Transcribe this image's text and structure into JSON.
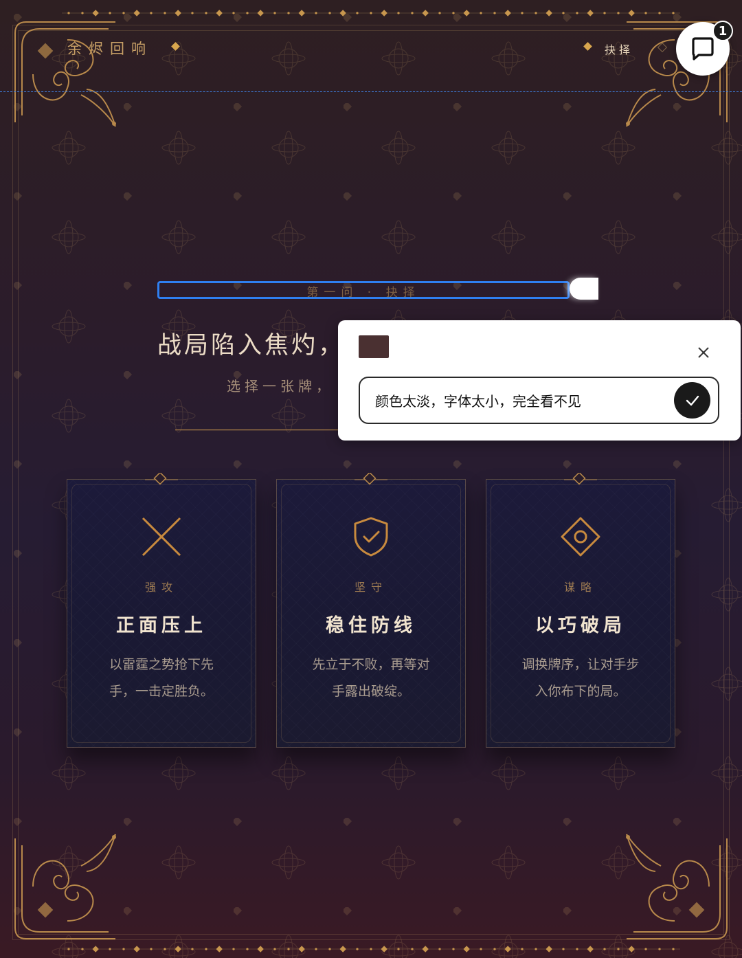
{
  "header": {
    "logo": "余烬回响",
    "nav_choice": "抉择"
  },
  "chat": {
    "badge_count": "1"
  },
  "main": {
    "section_label": "第一问 · 抉择",
    "headline": "战局陷入焦灼，",
    "subline": "选择一张牌，"
  },
  "feedback_popup": {
    "input_value": "颜色太淡，字体太小，完全看不见",
    "swatch_color": "#4a3031"
  },
  "cards": [
    {
      "tag": "强攻",
      "title": "正面压上",
      "desc_line1": "以雷霆之势抢下先",
      "desc_line2": "手，一击定胜负。",
      "icon": "crossed-swords-icon"
    },
    {
      "tag": "坚守",
      "title": "稳住防线",
      "desc_line1": "先立于不败，再等对",
      "desc_line2": "手露出破绽。",
      "icon": "shield-check-icon"
    },
    {
      "tag": "谋略",
      "title": "以巧破局",
      "desc_line1": "调换牌序，让对手步",
      "desc_line2": "入你布下的局。",
      "icon": "diamond-eye-icon"
    }
  ],
  "colors": {
    "accent_gold": "#c8a066",
    "highlight_blue": "#2f7ff0"
  }
}
